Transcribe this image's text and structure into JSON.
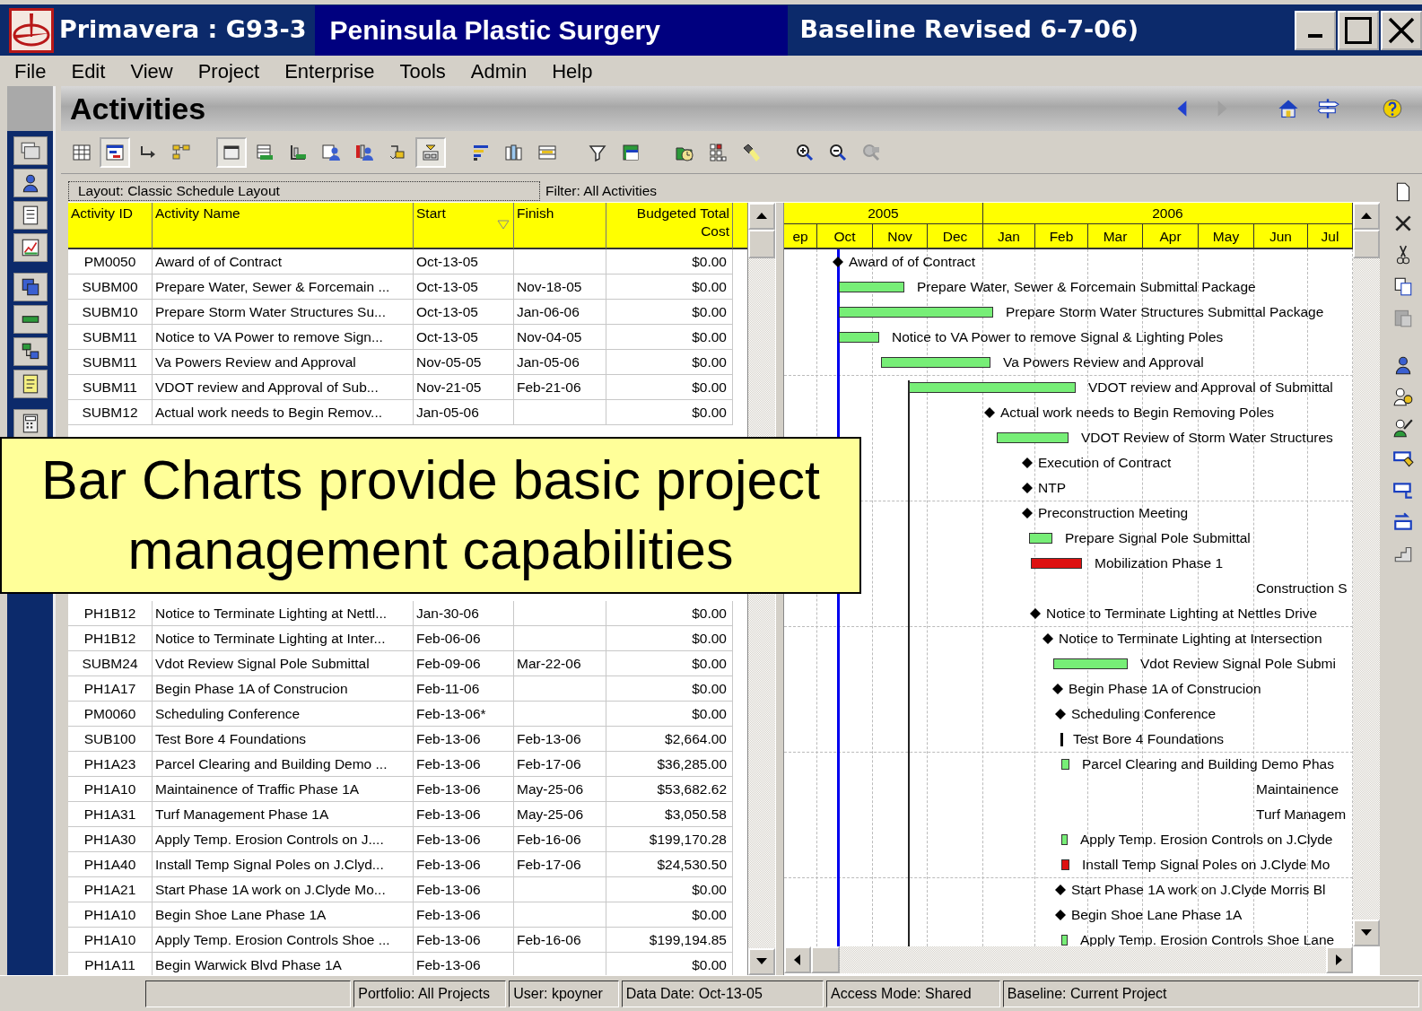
{
  "window": {
    "title_app": "Primavera : G93-3",
    "title_project": "Peninsula Plastic Surgery",
    "title_baseline": "Baseline Revised 6-7-06)"
  },
  "menu": [
    "File",
    "Edit",
    "View",
    "Project",
    "Enterprise",
    "Tools",
    "Admin",
    "Help"
  ],
  "page_title": "Activities",
  "nav": {
    "back": {
      "disabled": false
    },
    "forward": {
      "disabled": true
    }
  },
  "toolbar": [
    {
      "pressed": false
    },
    {
      "pressed": true
    },
    {
      "pressed": false
    },
    {
      "pressed": false
    },
    {
      "pressed": true
    },
    {
      "pressed": false
    },
    {
      "pressed": false
    },
    {
      "pressed": false
    },
    {
      "pressed": false
    },
    {
      "pressed": false
    },
    {
      "pressed": true
    },
    {
      "pressed": false
    },
    {
      "pressed": false
    },
    {
      "pressed": false
    },
    {
      "pressed": false
    },
    {
      "pressed": false
    },
    {
      "pressed": false
    },
    {
      "pressed": false
    },
    {
      "pressed": false
    },
    {
      "pressed": false
    },
    {
      "pressed": false
    },
    {
      "pressed": false
    }
  ],
  "layout_label": "Layout: Classic Schedule Layout",
  "filter_label": "Filter: All Activities",
  "table": {
    "columns": [
      "Activity ID",
      "Activity Name",
      "Start",
      "Finish",
      "Budgeted Total Cost"
    ],
    "rows_top": [
      {
        "id": "PM0050",
        "name": "Award of of Contract",
        "start": "Oct-13-05",
        "cost": "$0.00"
      },
      {
        "id": "SUBM00",
        "name": "Prepare Water, Sewer & Forcemain ...",
        "start": "Oct-13-05",
        "finish": "Nov-18-05",
        "cost": "$0.00"
      },
      {
        "id": "SUBM10",
        "name": "Prepare Storm Water Structures Su...",
        "start": "Oct-13-05",
        "finish": "Jan-06-06",
        "cost": "$0.00"
      },
      {
        "id": "SUBM11",
        "name": "Notice to VA Power to remove Sign...",
        "start": "Oct-13-05",
        "finish": "Nov-04-05",
        "cost": "$0.00"
      },
      {
        "id": "SUBM11",
        "name": "Va Powers Review and Approval",
        "start": "Nov-05-05",
        "finish": "Jan-05-06",
        "cost": "$0.00"
      },
      {
        "id": "SUBM11",
        "name": "VDOT review and Approval of Sub...",
        "start": "Nov-21-05",
        "finish": "Feb-21-06",
        "cost": "$0.00"
      },
      {
        "id": "SUBM12",
        "name": "Actual work needs to Begin Remov...",
        "start": "Jan-05-06",
        "cost": "$0.00"
      }
    ],
    "rows_bottom": [
      {
        "id": "PH1B12",
        "name": "Notice to Terminate Lighting at Nettl...",
        "start": "Jan-30-06",
        "cost": "$0.00"
      },
      {
        "id": "PH1B12",
        "name": "Notice to Terminate Lighting at Inter...",
        "start": "Feb-06-06",
        "cost": "$0.00"
      },
      {
        "id": "SUBM24",
        "name": "Vdot Review Signal Pole Submittal",
        "start": "Feb-09-06",
        "finish": "Mar-22-06",
        "cost": "$0.00"
      },
      {
        "id": "PH1A17",
        "name": "Begin Phase 1A of Construcion",
        "start": "Feb-11-06",
        "cost": "$0.00"
      },
      {
        "id": "PM0060",
        "name": "Scheduling Conference",
        "start": "Feb-13-06*",
        "cost": "$0.00"
      },
      {
        "id": "SUB100",
        "name": "Test Bore 4 Foundations",
        "start": "Feb-13-06",
        "finish": "Feb-13-06",
        "cost": "$2,664.00"
      },
      {
        "id": "PH1A23",
        "name": "Parcel Clearing and Building Demo ...",
        "start": "Feb-13-06",
        "finish": "Feb-17-06",
        "cost": "$36,285.00"
      },
      {
        "id": "PH1A10",
        "name": "Maintainence of Traffic Phase 1A",
        "start": "Feb-13-06",
        "finish": "May-25-06",
        "cost": "$53,682.62"
      },
      {
        "id": "PH1A31",
        "name": "Turf Management Phase 1A",
        "start": "Feb-13-06",
        "finish": "May-25-06",
        "cost": "$3,050.58"
      },
      {
        "id": "PH1A30",
        "name": "Apply Temp. Erosion Controls on J....",
        "start": "Feb-13-06",
        "finish": "Feb-16-06",
        "cost": "$199,170.28"
      },
      {
        "id": "PH1A40",
        "name": "Install Temp Signal Poles on J.Clyd...",
        "start": "Feb-13-06",
        "finish": "Feb-17-06",
        "cost": "$24,530.50"
      },
      {
        "id": "PH1A21",
        "name": "Start Phase 1A work on J.Clyde Mo...",
        "start": "Feb-13-06",
        "cost": "$0.00"
      },
      {
        "id": "PH1A10",
        "name": "Begin Shoe Lane Phase 1A",
        "start": "Feb-13-06",
        "cost": "$0.00"
      },
      {
        "id": "PH1A10",
        "name": "Apply Temp. Erosion Controls Shoe ...",
        "start": "Feb-13-06",
        "finish": "Feb-16-06",
        "cost": "$199,194.85"
      },
      {
        "id": "PH1A11",
        "name": "Begin Warwick Blvd Phase 1A",
        "start": "Feb-13-06",
        "cost": "$0.00"
      }
    ]
  },
  "timescale": {
    "years": [
      "2005",
      "2006"
    ],
    "months": [
      "ep",
      "Oct",
      "Nov",
      "Dec",
      "Jan",
      "Feb",
      "Mar",
      "Apr",
      "May",
      "Jun",
      "Jul"
    ]
  },
  "gantt": {
    "rows": [
      {
        "kind": "milestone",
        "label": "Award of of Contract"
      },
      {
        "kind": "bar",
        "color": "#77ee77",
        "label": "Prepare Water, Sewer & Forcemain Submittal Package"
      },
      {
        "kind": "bar",
        "color": "#77ee77",
        "label": "Prepare Storm Water Structures Submittal Package"
      },
      {
        "kind": "bar",
        "color": "#77ee77",
        "label": "Notice to VA Power to remove Signal & Lighting Poles"
      },
      {
        "kind": "bar",
        "color": "#77ee77",
        "label": "Va Powers Review and Approval"
      },
      {
        "kind": "bar",
        "color": "#77ee77",
        "label": "VDOT review and Approval of Submittal"
      },
      {
        "kind": "milestone",
        "label": "Actual work needs to Begin Removing Poles"
      },
      {
        "kind": "bar",
        "color": "#77ee77",
        "label": "VDOT Review of Storm Water Structures"
      },
      {
        "kind": "milestone",
        "label": "Execution of Contract"
      },
      {
        "kind": "milestone",
        "label": "NTP"
      },
      {
        "kind": "milestone",
        "label": "Preconstruction Meeting"
      },
      {
        "kind": "bar",
        "color": "#77ee77",
        "label": "Prepare Signal Pole Submittal"
      },
      {
        "kind": "bar",
        "color": "#dd1111",
        "label": "Mobilization Phase 1"
      },
      {
        "kind": "label",
        "label": "Construction S"
      },
      {
        "kind": "milestone",
        "label": "Notice to Terminate Lighting at Nettles Drive"
      },
      {
        "kind": "milestone",
        "label": "Notice to Terminate Lighting at Intersection"
      },
      {
        "kind": "bar",
        "color": "#77ee77",
        "label": "Vdot Review Signal Pole Submi"
      },
      {
        "kind": "milestone",
        "label": "Begin Phase 1A of Construcion"
      },
      {
        "kind": "milestone",
        "label": "Scheduling Conference"
      },
      {
        "kind": "tick",
        "label": "Test Bore 4 Foundations"
      },
      {
        "kind": "bar",
        "color": "#77ee77",
        "label": "Parcel Clearing and Building Demo Phas"
      },
      {
        "kind": "label",
        "label": "Maintainence"
      },
      {
        "kind": "label",
        "label": "Turf Managem"
      },
      {
        "kind": "bar",
        "color": "#77ee77",
        "label": "Apply Temp. Erosion Controls on J.Clyde"
      },
      {
        "kind": "bar",
        "color": "#dd1111",
        "label": "Install Temp Signal Poles on J.Clyde Mo"
      },
      {
        "kind": "milestone",
        "label": "Start Phase 1A work on J.Clyde Morris Bl"
      },
      {
        "kind": "milestone",
        "label": "Begin Shoe Lane Phase 1A"
      },
      {
        "kind": "bar",
        "color": "#77ee77",
        "label": "Apply Temp. Erosion Controls Shoe Lane"
      }
    ]
  },
  "callout": "Bar Charts provide basic project management capabilities",
  "status_bar": [
    "Portfolio: All Projects",
    "User: kpoyner",
    "Data Date: Oct-13-05",
    "Access Mode: Shared",
    "Baseline: Current Project"
  ]
}
